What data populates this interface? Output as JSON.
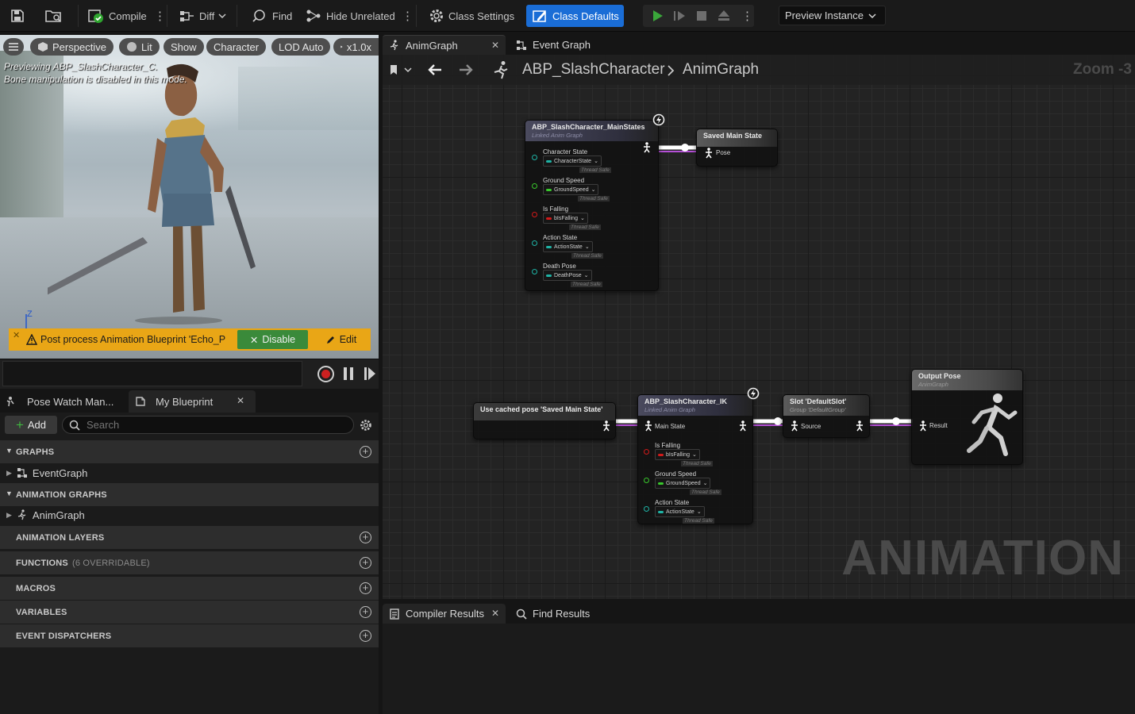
{
  "toolbar": {
    "compile": "Compile",
    "diff": "Diff",
    "find": "Find",
    "hide_unrelated": "Hide Unrelated",
    "class_settings": "Class Settings",
    "class_defaults": "Class Defaults",
    "preview_instance": "Preview Instance"
  },
  "viewport": {
    "buttons": {
      "perspective": "Perspective",
      "lit": "Lit",
      "show": "Show",
      "character": "Character",
      "lod": "LOD Auto",
      "speed": "x1.0x"
    },
    "line1": "Previewing ABP_SlashCharacter_C.",
    "line2": "Bone manipulation is disabled in this mode.",
    "axis_label": "Z",
    "warning": "Post process Animation Blueprint 'Echo_P",
    "disable": "Disable",
    "edit": "Edit"
  },
  "sidepanel": {
    "tabs": [
      {
        "label": "Pose Watch Man..."
      },
      {
        "label": "My Blueprint"
      }
    ],
    "add": "Add",
    "search_placeholder": "Search",
    "sections": {
      "graphs": "GRAPHS",
      "animation_graphs": "ANIMATION GRAPHS",
      "animation_layers": "ANIMATION LAYERS",
      "functions": "FUNCTIONS",
      "functions_note": "(6 OVERRIDABLE)",
      "macros": "MACROS",
      "variables": "VARIABLES",
      "event_dispatchers": "EVENT DISPATCHERS"
    },
    "items": {
      "event_graph": "EventGraph",
      "anim_graph": "AnimGraph"
    }
  },
  "graph": {
    "tabs": [
      {
        "label": "AnimGraph"
      },
      {
        "label": "Event Graph"
      }
    ],
    "breadcrumb": {
      "blueprint": "ABP_SlashCharacter",
      "graph": "AnimGraph"
    },
    "zoom": "Zoom -3",
    "watermark": "ANIMATION",
    "nodes": {
      "main_states": {
        "title": "ABP_SlashCharacter_MainStates",
        "subtitle": "Linked Anim Graph",
        "pins": [
          {
            "label": "Character State",
            "value": "CharacterState"
          },
          {
            "label": "Ground Speed",
            "value": "GroundSpeed"
          },
          {
            "label": "Is Falling",
            "value": "bIsFalling"
          },
          {
            "label": "Action State",
            "value": "ActionState"
          },
          {
            "label": "Death Pose",
            "value": "DeathPose"
          }
        ]
      },
      "saved_main_state": {
        "title": "Saved Main State",
        "pose": "Pose"
      },
      "cached_pose": {
        "title": "Use cached pose 'Saved Main State'"
      },
      "ik": {
        "title": "ABP_SlashCharacter_IK",
        "subtitle": "Linked Anim Graph",
        "main_state": "Main State",
        "pins": [
          {
            "label": "Is Falling",
            "value": "bIsFalling"
          },
          {
            "label": "Ground Speed",
            "value": "GroundSpeed"
          },
          {
            "label": "Action State",
            "value": "ActionState"
          }
        ]
      },
      "slot": {
        "title": "Slot 'DefaultSlot'",
        "subtitle": "Group 'DefaultGroup'",
        "source": "Source"
      },
      "output": {
        "title": "Output Pose",
        "subtitle": "AnimGraph",
        "result": "Result"
      }
    },
    "thread_safe": "Thread Safe"
  },
  "bottom": {
    "tabs": [
      {
        "label": "Compiler Results"
      },
      {
        "label": "Find Results"
      }
    ]
  },
  "colors": {
    "accent": "#1a6dd6",
    "warning": "#e9a616",
    "disable_green": "#3a8a3a",
    "play_green": "#3aa63a",
    "pin_cyan": "#1fb3a5",
    "pin_green": "#39c72c",
    "pin_red": "#d11a1a"
  }
}
